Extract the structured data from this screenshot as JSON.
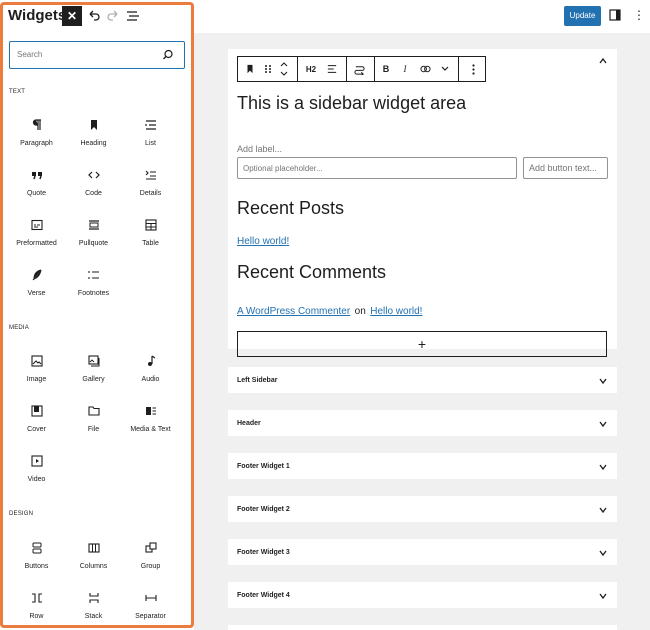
{
  "header": {
    "title": "Widgets",
    "close_glyph": "✕",
    "update_label": "Update",
    "more_glyph": "⋮"
  },
  "inserter": {
    "search_placeholder": "Search",
    "categories": {
      "text": "TEXT",
      "media": "MEDIA",
      "design": "DESIGN"
    },
    "text_blocks": [
      "Paragraph",
      "Heading",
      "List",
      "Quote",
      "Code",
      "Details",
      "Preformatted",
      "Pullquote",
      "Table",
      "Verse",
      "Footnotes"
    ],
    "media_blocks": [
      "Image",
      "Gallery",
      "Audio",
      "Cover",
      "File",
      "Media & Text",
      "Video"
    ],
    "design_blocks": [
      "Buttons",
      "Columns",
      "Group",
      "Row",
      "Stack",
      "Separator"
    ]
  },
  "main": {
    "active_area": {
      "heading": "This is a sidebar widget area",
      "add_label": "Add label...",
      "input_placeholder": "Optional placeholder...",
      "button_text": "Add button text...",
      "recent_posts_title": "Recent Posts",
      "recent_post_link": "Hello world!",
      "recent_comments_title": "Recent Comments",
      "comment_author": "A WordPress Commenter",
      "comment_on": "on",
      "comment_post": "Hello world!",
      "add_block_glyph": "+",
      "toolbar": {
        "heading_level": "H2",
        "bold": "B",
        "italic": "I"
      }
    },
    "widget_areas": [
      "Left Sidebar",
      "Header",
      "Footer Widget 1",
      "Footer Widget 2",
      "Footer Widget 3",
      "Footer Widget 4"
    ]
  },
  "colors": {
    "accent": "#2271b1",
    "highlight_frame": "#ec7b3e",
    "canvas_bg": "#f0f0f0"
  }
}
